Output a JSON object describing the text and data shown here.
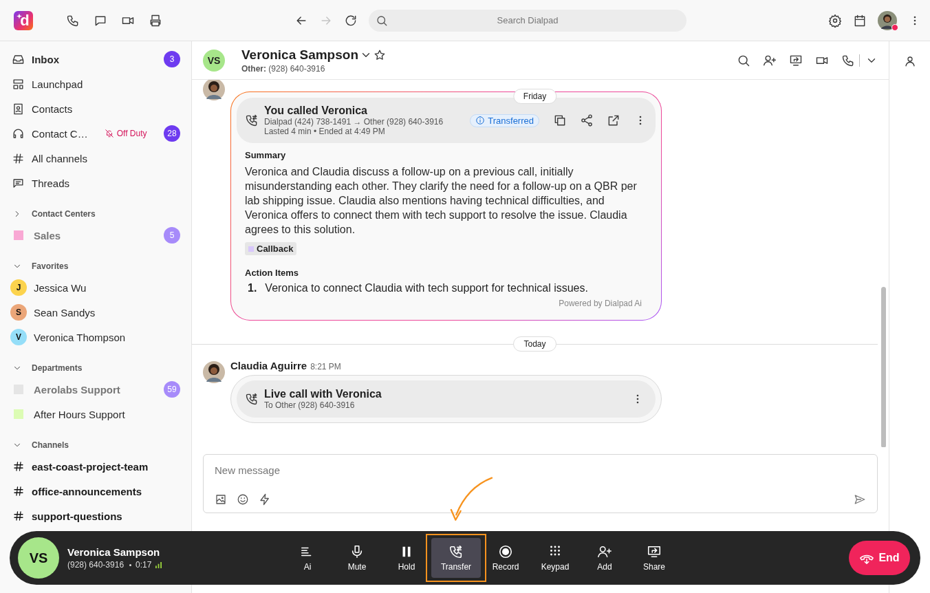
{
  "app": {
    "logo": "d",
    "search_placeholder": "Search Dialpad"
  },
  "sidebar": {
    "nav": [
      {
        "label": "Inbox",
        "bold": true,
        "count": "3"
      },
      {
        "label": "Launchpad",
        "bold": false
      },
      {
        "label": "Contacts",
        "bold": false
      },
      {
        "label": "Contact C…",
        "bold": false,
        "status": "Off Duty",
        "count": "28"
      },
      {
        "label": "All channels",
        "bold": false
      },
      {
        "label": "Threads",
        "bold": false
      }
    ],
    "sections": [
      {
        "title": "Contact Centers",
        "expanded": false,
        "items": [
          {
            "kind": "square",
            "label": "Sales",
            "color": "#f9a8d4",
            "muted": true,
            "count": "5"
          }
        ]
      },
      {
        "title": "Favorites",
        "expanded": true,
        "items": [
          {
            "kind": "avatar",
            "initial": "J",
            "label": "Jessica Wu",
            "color": "#fcd34d",
            "muted": false
          },
          {
            "kind": "avatar",
            "initial": "S",
            "label": "Sean Sandys",
            "color": "#eba679",
            "muted": false
          },
          {
            "kind": "avatar",
            "initial": "V",
            "label": "Veronica Thompson",
            "color": "#95def8",
            "muted": false
          }
        ]
      },
      {
        "title": "Departments",
        "expanded": true,
        "items": [
          {
            "kind": "square",
            "label": "Aerolabs Support",
            "color": "#e5e5e5",
            "muted": true,
            "count": "59"
          },
          {
            "kind": "square",
            "label": "After Hours Support",
            "color": "#dcfcb4",
            "muted": false
          }
        ]
      },
      {
        "title": "Channels",
        "expanded": true,
        "items": [
          {
            "kind": "channel",
            "label": "east-coast-project-team",
            "muted": false
          },
          {
            "kind": "channel",
            "label": "office-announcements",
            "muted": false
          },
          {
            "kind": "channel",
            "label": "support-questions",
            "muted": false
          }
        ]
      }
    ]
  },
  "conversation": {
    "initials": "VS",
    "name": "Veronica Sampson",
    "subtitle": "**Other:** (928) 640-3916",
    "starred": false,
    "sticky_date": "Friday",
    "messages": [
      {
        "kind": "summary_card",
        "title": "You called Veronica",
        "route": "Dialpad (424) 738-1491 → Other (928) 640-3916",
        "duration": "Lasted 4 min • Ended at 4:49 PM",
        "badge": "Transferred",
        "summary_heading": "Summary",
        "summary": "Veronica and Claudia discuss a follow-up on a previous call, initially misunderstanding each other. They clarify the need for a follow-up on a QBR per lab shipping issue. Claudia also mentions having technical difficulties, and Veronica offers to connect them with tech support to resolve the issue. Claudia agrees to this solution.",
        "tag": "Callback",
        "actions_heading": "Action Items",
        "actions": [
          {
            "number": "1.",
            "text": "Veronica to connect Claudia with tech support for technical issues."
          }
        ],
        "footer": "Powered by Dialpad Ai"
      },
      {
        "kind": "divider",
        "label": "Today"
      },
      {
        "kind": "live_call",
        "sender": "Claudia Aguirre",
        "time": "8:21 PM",
        "title": "Live call with Veronica",
        "subtitle": "To Other (928) 640-3916"
      }
    ],
    "composer": {
      "placeholder": "New message"
    }
  },
  "call_bar": {
    "initials": "VS",
    "name": "Veronica Sampson",
    "number": "(928) 640-3916",
    "duration": "0:17",
    "controls": [
      {
        "label": "Ai",
        "selected": false,
        "highlighted": false
      },
      {
        "label": "Mute",
        "selected": false,
        "highlighted": false
      },
      {
        "label": "Hold",
        "selected": false,
        "highlighted": false
      },
      {
        "label": "Transfer",
        "selected": true,
        "highlighted": true
      },
      {
        "label": "Record",
        "selected": false,
        "highlighted": false
      },
      {
        "label": "Keypad",
        "selected": false,
        "highlighted": false
      },
      {
        "label": "Add",
        "selected": false,
        "highlighted": false
      },
      {
        "label": "Share",
        "selected": false,
        "highlighted": false
      }
    ],
    "end_label": "End"
  }
}
